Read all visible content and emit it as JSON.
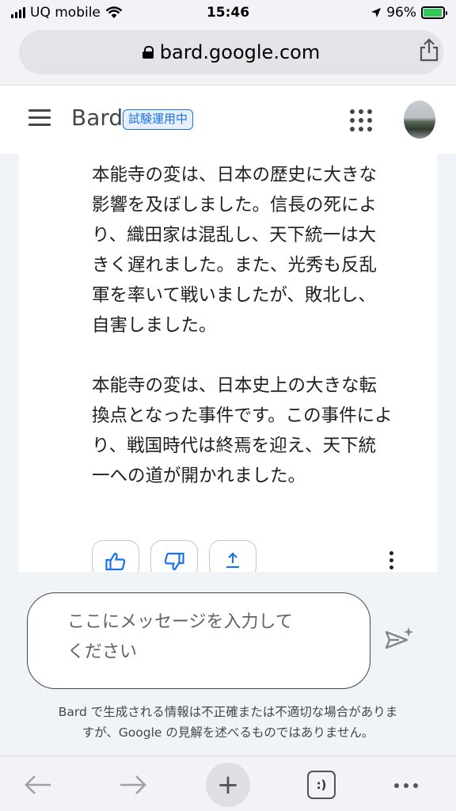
{
  "status_bar": {
    "carrier": "UQ mobile",
    "time": "15:46",
    "battery_percent": "96%",
    "battery_level": 0.96
  },
  "browser": {
    "url": "bard.google.com"
  },
  "header": {
    "brand": "Bard",
    "badge": "試験運用中"
  },
  "conversation": {
    "response_text": "本能寺の変は、日本の歴史に大きな\n影響を及ぼしました。信長の死によ\nり、織田家は混乱し、天下統一は大\nきく遅れました。また、光秀も反乱\n軍を率いて戦いましたが、敗北し、\n自害しました。\n\n本能寺の変は、日本史上の大きな転\n換点となった事件です。この事件によ\nり、戦国時代は終焉を迎え、天下統\n一への道が開かれました。"
  },
  "input": {
    "placeholder": "ここにメッセージを入力して\nください"
  },
  "disclaimer": "Bard で生成される情報は不正確または不適切な場合がありま\nすが、Google の見解を述べるものではありません。",
  "toolbar": {
    "new_tab": "+",
    "tabs_label": ":)"
  },
  "colors": {
    "accent": "#1a73e8",
    "background": "#f0f4f9"
  }
}
